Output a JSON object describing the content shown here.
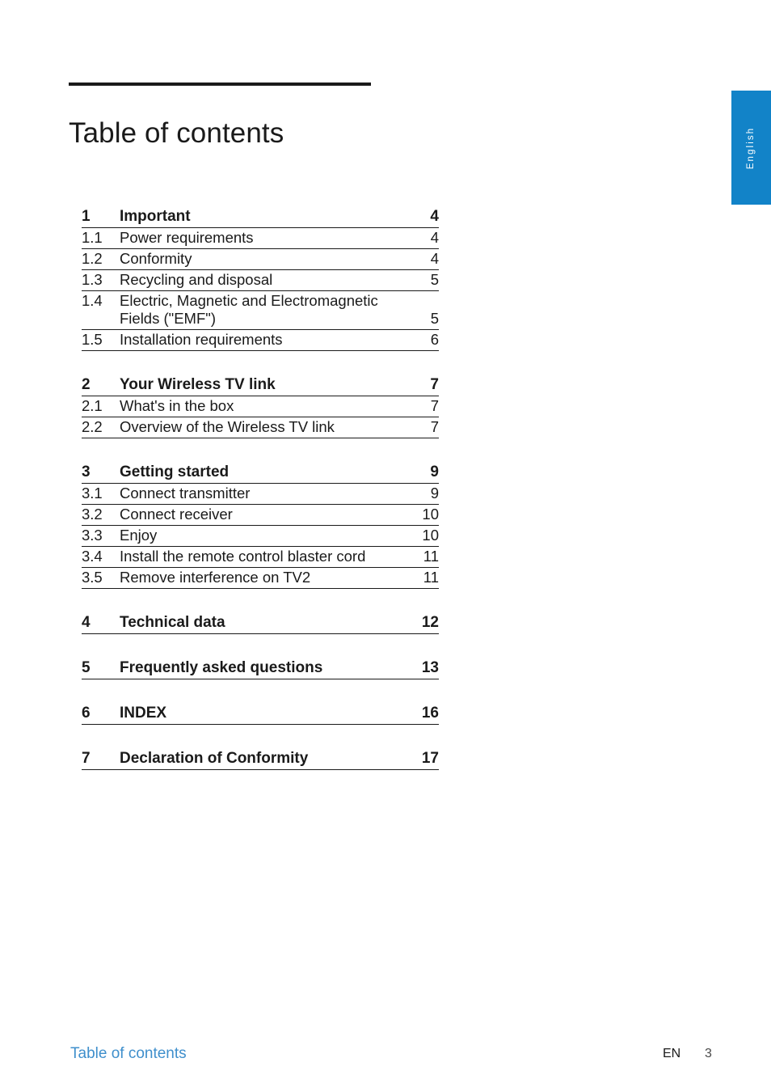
{
  "page": {
    "title": "Table of contents",
    "language_tab": "English"
  },
  "toc": {
    "groups": [
      {
        "entries": [
          {
            "num": "1",
            "label": "Important",
            "page": "4",
            "level": "major"
          },
          {
            "num": "1.1",
            "label": "Power requirements",
            "page": "4",
            "level": "sub"
          },
          {
            "num": "1.2",
            "label": "Conformity",
            "page": "4",
            "level": "sub"
          },
          {
            "num": "1.3",
            "label": "Recycling and disposal",
            "page": "5",
            "level": "sub"
          },
          {
            "num": "1.4",
            "label": "Electric, Magnetic and Electromagnetic",
            "label2": "Fields (\"EMF\")",
            "page": "5",
            "level": "sub-wrapped"
          },
          {
            "num": "1.5",
            "label": "Installation requirements",
            "page": "6",
            "level": "sub"
          }
        ]
      },
      {
        "entries": [
          {
            "num": "2",
            "label": "Your Wireless TV link",
            "page": "7",
            "level": "major"
          },
          {
            "num": "2.1",
            "label": "What's in the box",
            "page": "7",
            "level": "sub"
          },
          {
            "num": "2.2",
            "label": "Overview of the Wireless TV link",
            "page": "7",
            "level": "sub"
          }
        ]
      },
      {
        "entries": [
          {
            "num": "3",
            "label": "Getting started",
            "page": "9",
            "level": "major"
          },
          {
            "num": "3.1",
            "label": "Connect transmitter",
            "page": "9",
            "level": "sub"
          },
          {
            "num": "3.2",
            "label": "Connect receiver",
            "page": "10",
            "level": "sub"
          },
          {
            "num": "3.3",
            "label": "Enjoy",
            "page": "10",
            "level": "sub"
          },
          {
            "num": "3.4",
            "label": "Install the remote control blaster cord",
            "page": "11",
            "level": "sub"
          },
          {
            "num": "3.5",
            "label": "Remove interference on TV2",
            "page": "11",
            "level": "sub"
          }
        ]
      },
      {
        "entries": [
          {
            "num": "4",
            "label": "Technical data",
            "page": "12",
            "level": "major"
          }
        ]
      },
      {
        "entries": [
          {
            "num": "5",
            "label": "Frequently asked questions",
            "page": "13",
            "level": "major"
          }
        ]
      },
      {
        "entries": [
          {
            "num": "6",
            "label": "INDEX",
            "page": "16",
            "level": "major"
          }
        ]
      },
      {
        "entries": [
          {
            "num": "7",
            "label": "Declaration of Conformity",
            "page": "17",
            "level": "major"
          }
        ]
      }
    ]
  },
  "footer": {
    "left_label": "Table of contents",
    "language_code": "EN",
    "page_number": "3"
  },
  "colors": {
    "tab_blue": "#1283c8",
    "footer_blue": "#3f8fcc",
    "text": "#1a1a1a"
  }
}
